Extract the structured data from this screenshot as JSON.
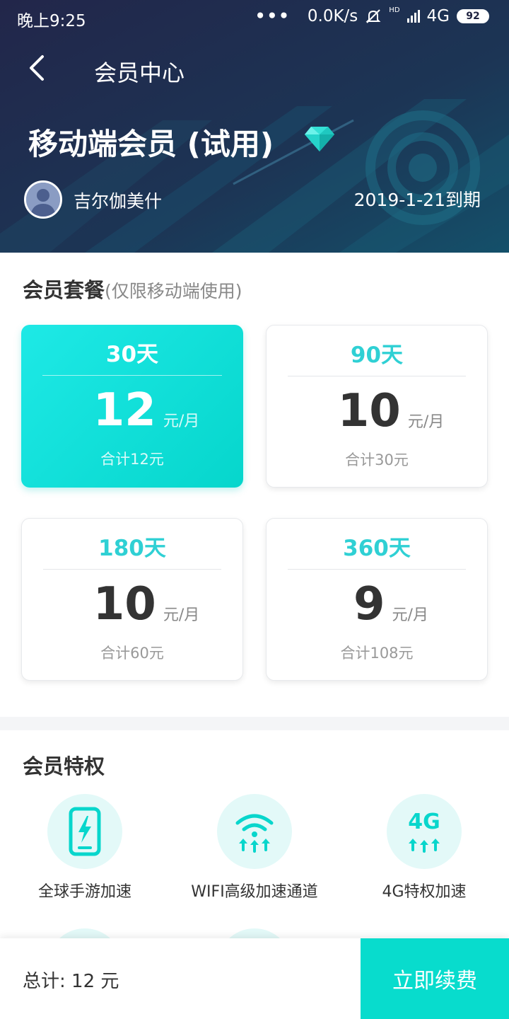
{
  "status_bar": {
    "time": "晚上9:25",
    "dots": "•••",
    "network_speed": "0.0K/s",
    "hd_label": "HD",
    "network_type": "4G",
    "battery": "92"
  },
  "nav": {
    "title": "会员中心"
  },
  "membership": {
    "plan_name": "移动端会员 (试用)",
    "username": "吉尔伽美什",
    "expire_text": "2019-1-21到期"
  },
  "packages": {
    "title": "会员套餐",
    "subtitle": "(仅限移动端使用)",
    "unit": "元/月",
    "items": [
      {
        "days": "30天",
        "price": "12",
        "total": "合计12元",
        "selected": true
      },
      {
        "days": "90天",
        "price": "10",
        "total": "合计30元",
        "selected": false
      },
      {
        "days": "180天",
        "price": "10",
        "total": "合计60元",
        "selected": false
      },
      {
        "days": "360天",
        "price": "9",
        "total": "合计108元",
        "selected": false
      }
    ]
  },
  "privileges": {
    "title": "会员特权",
    "items": [
      {
        "label": "全球手游加速",
        "icon": "phone-lightning-icon"
      },
      {
        "label": "WIFI高级加速通道",
        "icon": "wifi-boost-icon"
      },
      {
        "label": "4G特权加速",
        "icon": "4g-boost-icon",
        "icon_text": "4G"
      }
    ]
  },
  "bottom_bar": {
    "total_label": "总计: 12 元",
    "renew_label": "立即续费"
  },
  "colors": {
    "accent": "#08dccd",
    "header_bg": "#1f2340",
    "privilege_bg": "#e3f9f8"
  }
}
